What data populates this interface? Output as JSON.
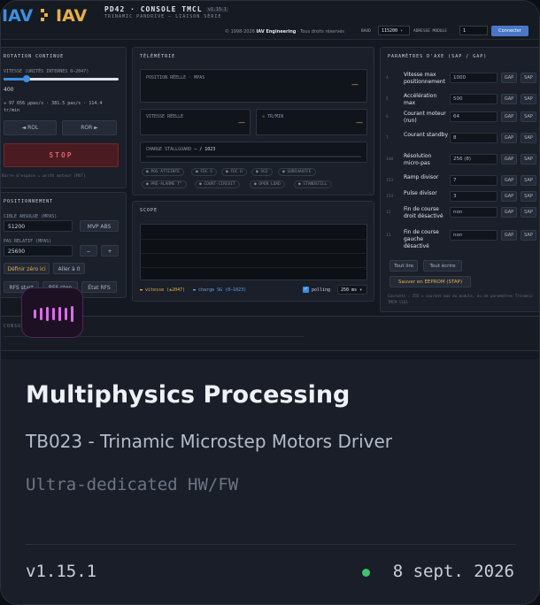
{
  "screenshot": {
    "brand_left": "IAV",
    "brand_right": "IAV",
    "app_title": "PD42 · CONSOLE TMCL",
    "app_version": "v1.15.1",
    "app_subtitle": "TRINAMIC PANDRIVE — LIAISON SÉRIE",
    "copyright_prefix": "© 1998-2026",
    "copyright_company": "IAV Engineering",
    "copyright_suffix": "· Tous droits réservés",
    "baud_label": "BAUD",
    "baud_value": "115200",
    "address_label": "ADRESSE MODULE",
    "address_value": "1",
    "connect_label": "Connecter",
    "rotation": {
      "title": "ROTATION CONTINUE",
      "speed_label": "VITESSE (UNITÉS INTERNES 0–2047)",
      "speed_value": "400",
      "slider_fraction": 0.2,
      "info_line1": "≈ 97 656 µpas/s · 381.5 pas/s · 114.4",
      "info_line2": "tr/min",
      "rol_label": "◄ ROL",
      "ror_label": "ROR ►",
      "stop_label": "STOP",
      "hint": "Barre d'espace = arrêt moteur (MST)"
    },
    "positioning": {
      "title": "POSITIONNEMENT",
      "abs_label": "CIBLE ABSOLUE (MPAS)",
      "abs_value": "51200",
      "mvp_abs": "MVP ABS",
      "rel_label": "PAS RELATIF (MPAS)",
      "rel_value": "25600",
      "minus": "−",
      "plus": "+",
      "define_zero": "Définir zéro ici",
      "goto_zero": "Aller à 0",
      "rfs_start": "RFS start",
      "rfs_stop": "RFS stop",
      "rfs_state": "État RFS"
    },
    "telemetry": {
      "title": "TÉLÉMÉTRIE",
      "position_label": "POSITION RÉELLE · MPAS",
      "position_value": "—",
      "speed_label": "VITESSE RÉELLE",
      "speed_value": "—",
      "rpm_label": "≈ TR/MIN",
      "rpm_value": "—",
      "stallguard_label": "CHARGE STALLGUARD",
      "stallguard_value": "— / 1023",
      "flags": [
        "POS ATTEINTE",
        "FDC G",
        "FDC D",
        "SG2",
        "SURCHAUFFE",
        "PRÉ-ALARME T°",
        "COURT-CIRCUIT",
        "OPEN LOAD",
        "STANDSTILL"
      ]
    },
    "scope": {
      "title": "SCOPE",
      "legend_speed": "vitesse (±2047)",
      "legend_load": "charge SG (0–1023)",
      "polling_label": "polling",
      "polling_interval": "250 ms"
    },
    "axis_params": {
      "title": "PARAMÈTRES D'AXE (SAP / GAP)",
      "gap_label": "GAP",
      "sap_label": "SAP",
      "rows": [
        {
          "num": "4",
          "label": "Vitesse max positionnement",
          "value": "1000"
        },
        {
          "num": "5",
          "label": "Accélération max",
          "value": "500"
        },
        {
          "num": "6",
          "label": "Courant moteur (run)",
          "value": "64"
        },
        {
          "num": "7",
          "label": "Courant standby",
          "value": "8"
        },
        {
          "num": "140",
          "label": "Résolution micro-pas",
          "value": "256 (8)"
        },
        {
          "num": "153",
          "label": "Ramp divisor",
          "value": "7"
        },
        {
          "num": "154",
          "label": "Pulse divisor",
          "value": "3"
        },
        {
          "num": "12",
          "label": "Fin de course droit désactivé",
          "value": "non"
        },
        {
          "num": "13",
          "label": "Fin de course gauche désactivé",
          "value": "non"
        }
      ],
      "read_all": "Tout lire",
      "write_all": "Tout écrire",
      "save_eeprom": "Sauver en EEPROM (STAP)",
      "footnote_line1": "Courants : 255 = courant max du module, au de paramètres Trinamic",
      "footnote_line2": "TMCM-1161"
    },
    "console_label": "CONSOLE"
  },
  "card": {
    "title": "Multiphysics Processing",
    "subtitle": "TB023 - Trinamic Microstep Motors Driver",
    "tagline": "Ultra-dedicated HW/FW",
    "version": "v1.15.1",
    "date": "8 sept. 2026",
    "status_color": "#3ec46d",
    "accent_color": "#d96ee8",
    "icon": "waveform-icon"
  }
}
